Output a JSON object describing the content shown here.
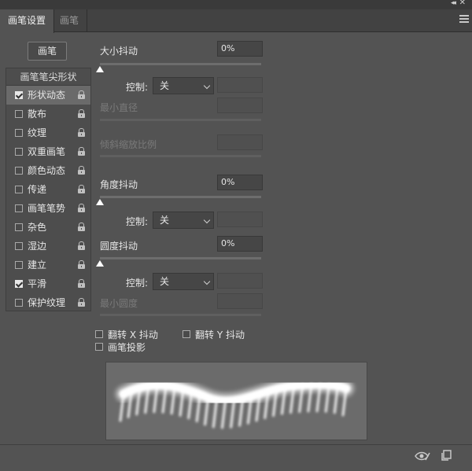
{
  "window": {
    "collapse_glyph": "◂◂",
    "close_glyph": "✕"
  },
  "tabs": [
    {
      "label": "画笔设置",
      "active": true
    },
    {
      "label": "画笔",
      "active": false
    }
  ],
  "brushes_button": "画笔",
  "tip_header": "画笔笔尖形状",
  "options": [
    {
      "label": "形状动态",
      "checked": true
    },
    {
      "label": "散布",
      "checked": false
    },
    {
      "label": "纹理",
      "checked": false
    },
    {
      "label": "双重画笔",
      "checked": false
    },
    {
      "label": "颜色动态",
      "checked": false
    },
    {
      "label": "传递",
      "checked": false
    },
    {
      "label": "画笔笔势",
      "checked": false
    },
    {
      "label": "杂色",
      "checked": false
    },
    {
      "label": "湿边",
      "checked": false
    },
    {
      "label": "建立",
      "checked": false
    },
    {
      "label": "平滑",
      "checked": true
    },
    {
      "label": "保护纹理",
      "checked": false
    }
  ],
  "size_jitter": {
    "label": "大小抖动",
    "value": "0%"
  },
  "control_label": "控制:",
  "control_value": "关",
  "min_diameter": "最小直径",
  "tilt_scale": "倾斜缩放比例",
  "angle_jitter": {
    "label": "角度抖动",
    "value": "0%"
  },
  "roundness_jitter": {
    "label": "圆度抖动",
    "value": "0%"
  },
  "min_roundness": "最小圆度",
  "flip_x": "翻转 X 抖动",
  "flip_y": "翻转 Y 抖动",
  "brush_projection": "画笔投影",
  "icons": {
    "menu": "panel-menu-icon",
    "eye": "toggle-preview-icon",
    "new": "create-new-brush-icon"
  }
}
